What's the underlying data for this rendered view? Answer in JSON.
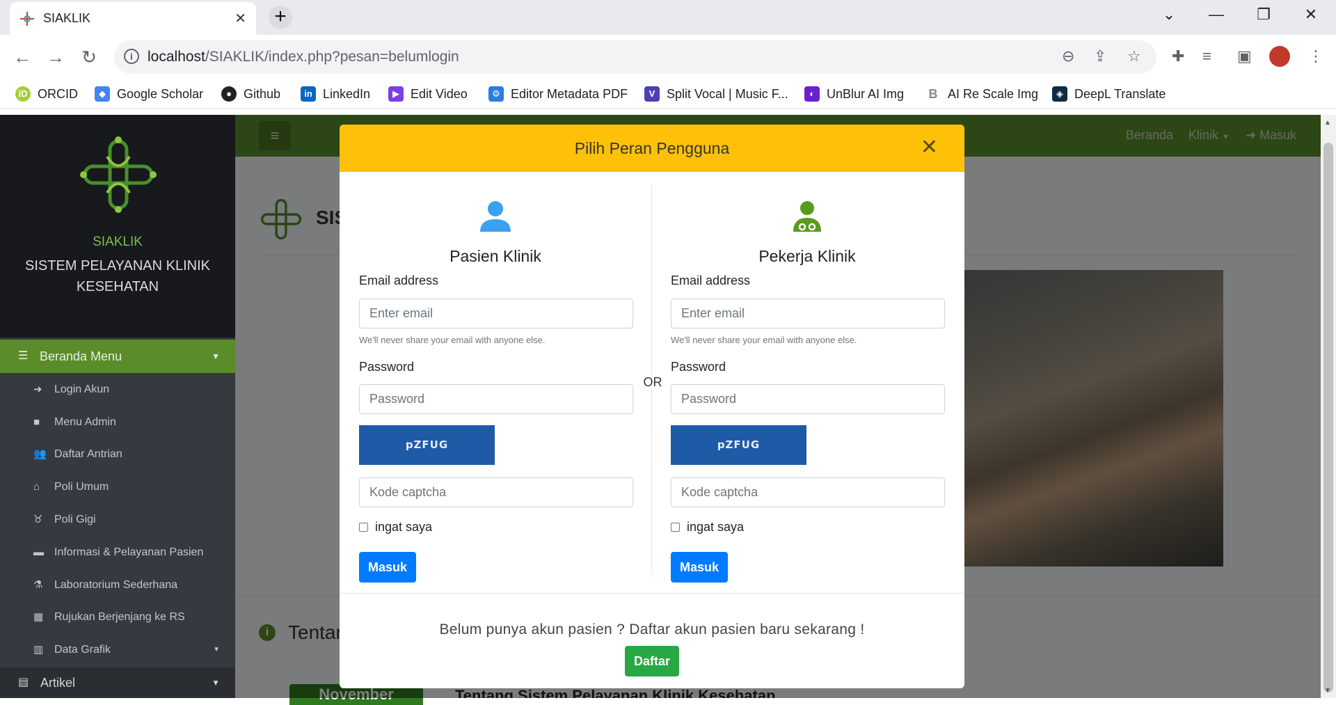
{
  "browser": {
    "tab_title": "SIAKLIK",
    "tab_close": "✕",
    "new_tab": "+",
    "url_host": "localhost",
    "url_path": "/SIAKLIK/index.php?pesan=belumlogin",
    "bookmarks": [
      {
        "label": "ORCID",
        "icon": "orcid-icon",
        "color": "#a6ce39"
      },
      {
        "label": "Google Scholar",
        "icon": "google-scholar-icon",
        "color": "#4285f4"
      },
      {
        "label": "Github",
        "icon": "github-icon",
        "color": "#222222"
      },
      {
        "label": "LinkedIn",
        "icon": "linkedin-icon",
        "color": "#0a66c2"
      },
      {
        "label": "Edit Video",
        "icon": "video-editor-icon",
        "color": "#7b3fe4"
      },
      {
        "label": "Editor Metadata PDF",
        "icon": "metadata-icon",
        "color": "#2a7de1"
      },
      {
        "label": "Split Vocal | Music F...",
        "icon": "vocal-icon",
        "color": "#4b3fb5"
      },
      {
        "label": "UnBlur AI Img",
        "icon": "unblur-icon",
        "color": "#6a1fd1"
      },
      {
        "label": "AI Re Scale Img",
        "icon": "rescale-icon",
        "color": "#888888"
      },
      {
        "label": "DeepL Translate",
        "icon": "deepl-icon",
        "color": "#0f2b46"
      }
    ]
  },
  "sidebar": {
    "brand_title": "SIAKLIK",
    "brand_subtitle": "SISTEM PELAYANAN KLINIK KESEHATAN",
    "menu_header": "Beranda Menu",
    "items": [
      {
        "label": "Login Akun",
        "icon": "sign-in-icon"
      },
      {
        "label": "Menu Admin",
        "icon": "admin-book-icon"
      },
      {
        "label": "Daftar Antrian",
        "icon": "users-icon"
      },
      {
        "label": "Poli Umum",
        "icon": "clinic-house-icon"
      },
      {
        "label": "Poli Gigi",
        "icon": "tooth-icon"
      },
      {
        "label": "Informasi & Pelayanan Pasien",
        "icon": "bed-icon"
      },
      {
        "label": "Laboratorium Sederhana",
        "icon": "flask-icon"
      },
      {
        "label": "Rujukan Berjenjang ke RS",
        "icon": "hospital-user-icon"
      },
      {
        "label": "Data Grafik",
        "icon": "chart-icon"
      }
    ],
    "artikel": "Artikel"
  },
  "topnav": {
    "beranda": "Beranda",
    "klinik": "Klinik",
    "masuk": "Masuk"
  },
  "page": {
    "heading_partial": "SIS",
    "section_partial": "Tentan",
    "ribbon_partial": "November",
    "article_partial": "Tentang Sistem Pelayanan Klinik Kesehatan"
  },
  "modal": {
    "title": "Pilih Peran Pengguna",
    "or_label": "OR",
    "left": {
      "title": "Pasien Klinik",
      "icon": "user-icon",
      "icon_color": "#3aa0f0",
      "email_label": "Email address",
      "email_placeholder": "Enter email",
      "email_help": "We'll never share your email with anyone else.",
      "password_label": "Password",
      "password_placeholder": "Password",
      "captcha_text": "pZFUG",
      "captcha_placeholder": "Kode captcha",
      "remember_label": "ingat saya",
      "submit_label": "Masuk"
    },
    "right": {
      "title": "Pekerja Klinik",
      "icon": "doctor-icon",
      "icon_color": "#5a9a1e",
      "email_label": "Email address",
      "email_placeholder": "Enter email",
      "email_help": "We'll never share your email with anyone else.",
      "password_label": "Password",
      "password_placeholder": "Password",
      "captcha_text": "pZFUG",
      "captcha_placeholder": "Kode captcha",
      "remember_label": "ingat saya",
      "submit_label": "Masuk"
    },
    "footer_text": "Belum punya akun pasien ? Daftar akun pasien baru sekarang !",
    "register_label": "Daftar"
  }
}
